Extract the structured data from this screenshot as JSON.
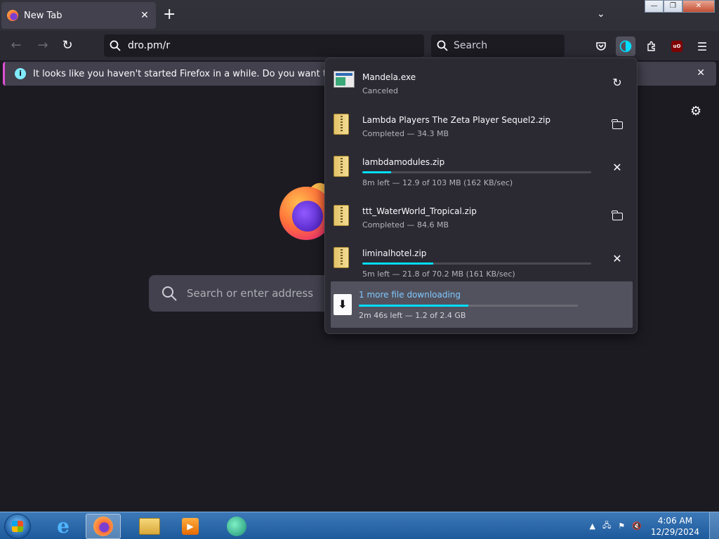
{
  "tab": {
    "title": "New Tab"
  },
  "window_controls": {
    "minimize": "—",
    "restore": "❐",
    "close": "✕"
  },
  "navbar": {
    "url": "dro.pm/r",
    "search_placeholder": "Search"
  },
  "notification": {
    "message": "It looks like you haven't started Firefox in a while. Do you want to clean it up for"
  },
  "newtab": {
    "search_placeholder": "Search or enter address"
  },
  "downloads": {
    "items": [
      {
        "name": "Mandela.exe",
        "status": "Canceled",
        "icon": "exe-file-icon",
        "action": "retry-icon"
      },
      {
        "name": "Lambda Players The Zeta Player Sequel2.zip",
        "status": "Completed — 34.3 MB",
        "icon": "zip-file-icon",
        "action": "folder-icon"
      },
      {
        "name": "lambdamodules.zip",
        "status": "8m left — 12.9 of 103 MB (162 KB/sec)",
        "progress": 0.125,
        "icon": "zip-file-icon",
        "action": "cancel-icon"
      },
      {
        "name": "ttt_WaterWorld_Tropical.zip",
        "status": "Completed — 84.6 MB",
        "icon": "zip-file-icon",
        "action": "folder-icon"
      },
      {
        "name": "liminalhotel.zip",
        "status": "5m left — 21.8 of 70.2 MB (161 KB/sec)",
        "progress": 0.31,
        "icon": "zip-file-icon",
        "action": "cancel-icon"
      }
    ],
    "more": {
      "title": "1 more file downloading",
      "status": "2m 46s left — 1.2 of 2.4 GB",
      "progress": 0.5
    }
  },
  "taskbar": {
    "clock_time": "4:06 AM",
    "clock_date": "12/29/2024"
  },
  "colors": {
    "accent": "#00ddff",
    "panel": "#2b2a33",
    "background": "#1c1b22"
  }
}
